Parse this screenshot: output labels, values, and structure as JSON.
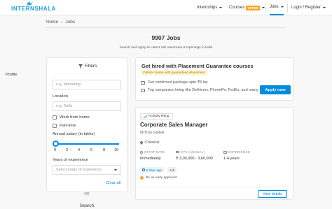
{
  "header": {
    "logo_text": "INTERNSHALA",
    "nav": {
      "internships": "Internships",
      "courses": "Courses",
      "offer_badge": "OFFER",
      "jobs": "Jobs",
      "login": "Login / Register"
    }
  },
  "breadcrumb": {
    "home": "Home",
    "separator": "›",
    "current": "Jobs"
  },
  "results": {
    "count_title": "9907 Jobs",
    "subtitle": "Search and Apply to Latest Job Vacancies & Openings in India"
  },
  "filters": {
    "heading": "Filters",
    "profile_label": "Profile",
    "profile_placeholder": "e.g. Marketing",
    "location_label": "Location",
    "location_placeholder": "e.g. Delhi",
    "work_from_home": "Work from home",
    "part_time": "Part-time",
    "salary_label": "Annual salary (in lakhs)",
    "salary_ticks": [
      "0",
      "2",
      "4",
      "6",
      "8",
      "10"
    ],
    "salary_selected": 0,
    "experience_label": "Years of experience",
    "experience_placeholder": "Select years of experience",
    "clear_all": "Clear all"
  },
  "search": {
    "or": "OR",
    "label": "Search"
  },
  "promo": {
    "title": "Get hired with Placement Guarantee courses",
    "badge": "Online course with guaranteed placement",
    "line1": "Get confirmed package upto ₹5 lac",
    "line2": "Top companies hiring like Delhivery, PhonePe, FedEx, and many",
    "apply_button": "Apply now"
  },
  "job": {
    "status": "Actively hiring",
    "title": "Corporate Sales Manager",
    "company": "MiTran Global",
    "location": "Chennai",
    "start_date_label": "START DATE",
    "start_date": "Immediately",
    "ctc_label": "CTC (ANNUAL)",
    "ctc": "₹ 3,00,000 - 3,60,000",
    "experience_label": "EXPERIENCE",
    "experience": "1-4 years",
    "posted": "5 days ago",
    "type": "Job",
    "early": "Be an early applicant",
    "view_button": "View details"
  },
  "colors": {
    "accent": "#008bdc",
    "offer": "#f5a623",
    "badge_bg": "#fff5d6"
  }
}
